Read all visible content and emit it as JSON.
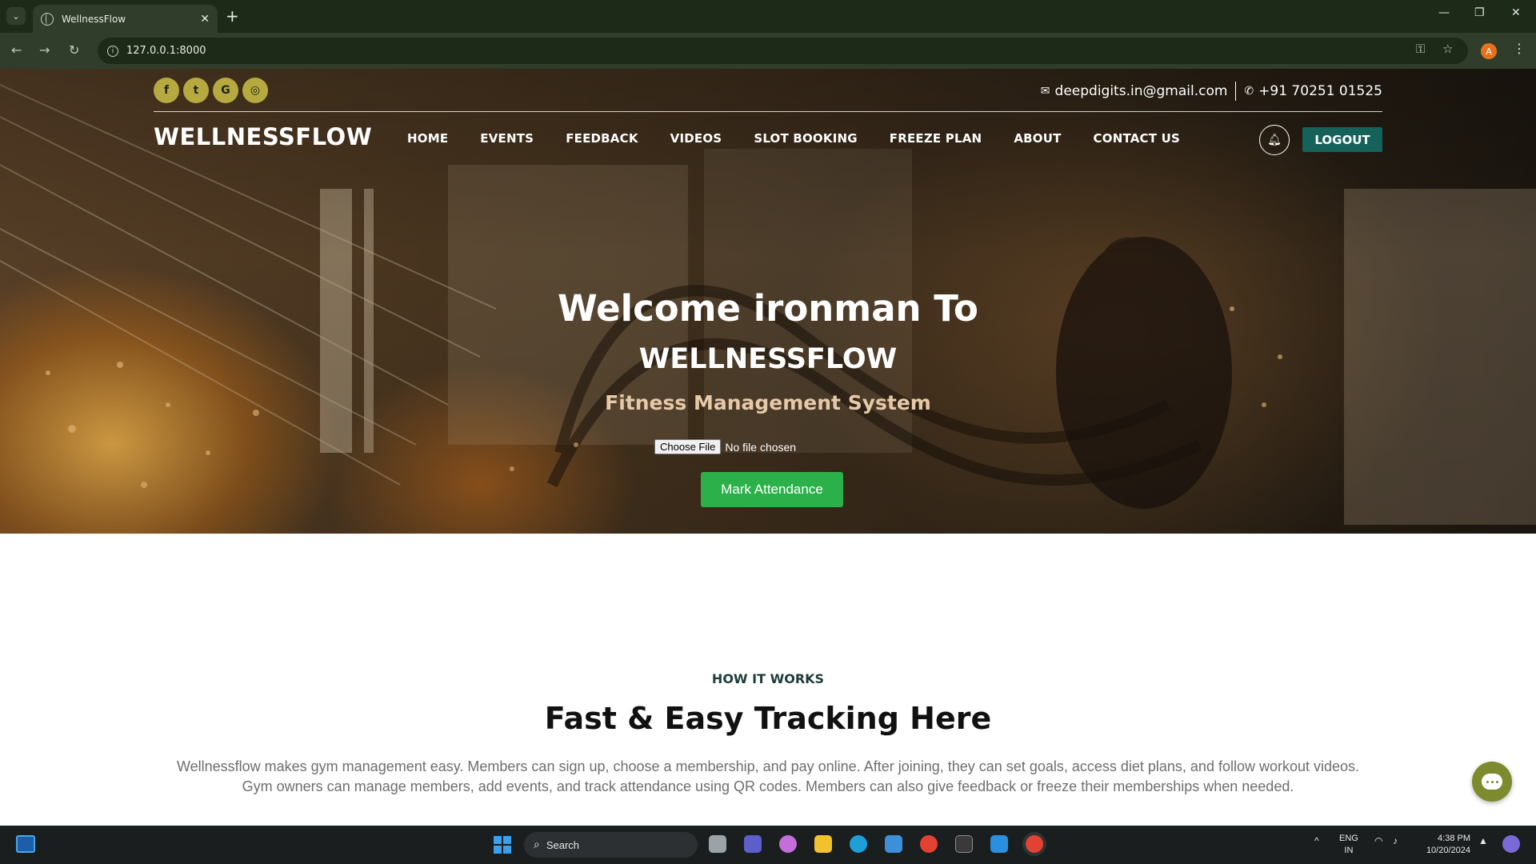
{
  "browser": {
    "tab_title": "WellnessFlow",
    "url": "127.0.0.1:8000",
    "profile_initial": "A"
  },
  "topbar": {
    "social": [
      {
        "icon": "facebook-icon",
        "glyph": "f"
      },
      {
        "icon": "twitter-icon",
        "glyph": "t"
      },
      {
        "icon": "google-icon",
        "glyph": "G"
      },
      {
        "icon": "instagram-icon",
        "glyph": "◎"
      }
    ],
    "email": "deepdigits.in@gmail.com",
    "phone": "+91 70251 01525"
  },
  "navbar": {
    "brand": "WELLNESSFLOW",
    "links": [
      "HOME",
      "EVENTS",
      "FEEDBACK",
      "VIDEOS",
      "SLOT BOOKING",
      "FREEZE PLAN",
      "ABOUT",
      "CONTACT US"
    ],
    "logout_label": "LOGOUT"
  },
  "hero": {
    "welcome": "Welcome ironman To",
    "brand": "WELLNESSFLOW",
    "subtitle": "Fitness Management System",
    "file_button": "Choose File",
    "file_status": "No file chosen",
    "attendance_button": "Mark Attendance"
  },
  "how_it_works": {
    "eyebrow": "HOW IT WORKS",
    "title": "Fast & Easy Tracking Here",
    "description_line1": "Wellnessflow makes gym management easy. Members can sign up, choose a membership, and pay online. After joining, they can set goals, access diet plans, and follow workout videos.",
    "description_line2": "Gym owners can manage members, add events, and track attendance using QR codes. Members can also give feedback or freeze their memberships when needed."
  },
  "taskbar": {
    "search_label": "Search",
    "lang_line1": "ENG",
    "lang_line2": "IN",
    "time": "4:38 PM",
    "date": "10/20/2024"
  },
  "colors": {
    "accent_teal": "#15625a",
    "attendance_green": "#2bb04a",
    "social_olive": "#b5a93f",
    "chat_olive": "#7d8a2d"
  }
}
